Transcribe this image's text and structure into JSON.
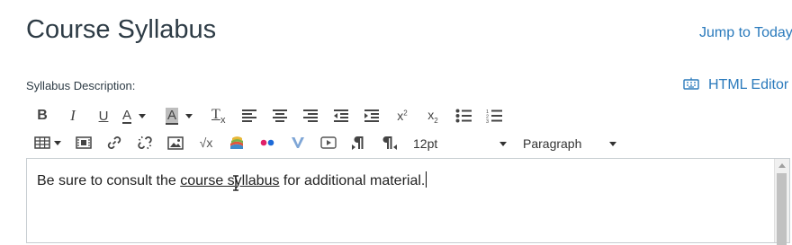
{
  "page": {
    "title": "Course Syllabus",
    "jump_link": "Jump to Today"
  },
  "syllabus": {
    "label": "Syllabus Description:",
    "html_editor_label": "HTML Editor"
  },
  "toolbar": {
    "row1": [
      {
        "name": "bold-button",
        "icon": "bold-icon",
        "glyph": "B"
      },
      {
        "name": "italic-button",
        "icon": "italic-icon",
        "glyph": "I"
      },
      {
        "name": "underline-button",
        "icon": "underline-icon",
        "glyph": "U"
      },
      {
        "name": "text-color-button",
        "icon": "text-color-icon",
        "glyph": "A"
      },
      {
        "name": "background-color-button",
        "icon": "background-color-icon",
        "glyph": "A"
      },
      {
        "name": "clear-formatting-button",
        "icon": "clear-formatting-icon",
        "glyph": "T"
      },
      {
        "name": "align-left-button",
        "icon": "align-left-icon"
      },
      {
        "name": "align-center-button",
        "icon": "align-center-icon"
      },
      {
        "name": "align-right-button",
        "icon": "align-right-icon"
      },
      {
        "name": "outdent-button",
        "icon": "outdent-icon"
      },
      {
        "name": "indent-button",
        "icon": "indent-icon"
      },
      {
        "name": "superscript-button",
        "icon": "superscript-icon",
        "glyph": "x"
      },
      {
        "name": "subscript-button",
        "icon": "subscript-icon",
        "glyph": "x"
      },
      {
        "name": "bullet-list-button",
        "icon": "bullet-list-icon"
      },
      {
        "name": "numbered-list-button",
        "icon": "numbered-list-icon"
      }
    ],
    "row2": [
      {
        "name": "table-button",
        "icon": "table-icon"
      },
      {
        "name": "media-button",
        "icon": "media-icon"
      },
      {
        "name": "link-button",
        "icon": "link-icon"
      },
      {
        "name": "unlink-button",
        "icon": "unlink-icon"
      },
      {
        "name": "image-button",
        "icon": "image-icon"
      },
      {
        "name": "equation-button",
        "icon": "equation-icon",
        "glyph": "√x"
      },
      {
        "name": "books-button",
        "icon": "books-icon"
      },
      {
        "name": "flickr-button",
        "icon": "flickr-icon"
      },
      {
        "name": "vimeo-button",
        "icon": "v-icon"
      },
      {
        "name": "video-button",
        "icon": "video-play-icon"
      },
      {
        "name": "ltr-button",
        "icon": "paragraph-ltr-icon"
      },
      {
        "name": "rtl-button",
        "icon": "paragraph-rtl-icon"
      }
    ],
    "font_size": "12pt",
    "block_format": "Paragraph"
  },
  "editor": {
    "text_before": "Be sure to consult the ",
    "link_text": "course syllabus",
    "text_after": " for additional material."
  },
  "colors": {
    "link": "#2a7abc",
    "text": "#2d3b45",
    "border": "#c7cdd1"
  }
}
